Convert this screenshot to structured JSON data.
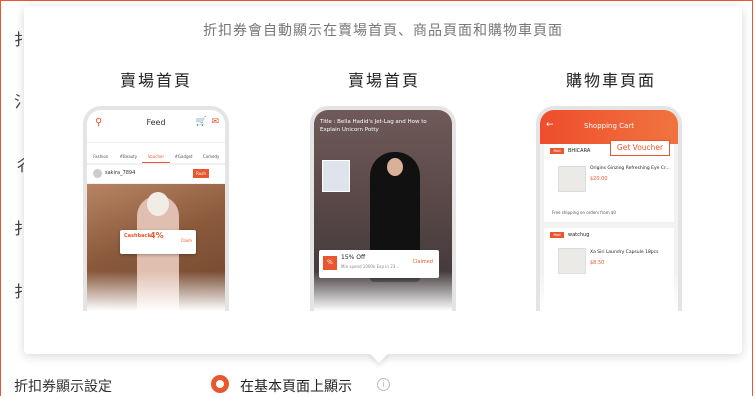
{
  "popover": {
    "caption": "折扣券會自動顯示在賣場首頁、商品頁面和購物車頁面",
    "columns": [
      {
        "title": "賣場首頁"
      },
      {
        "title": "賣場首頁"
      },
      {
        "title": "購物車頁面"
      }
    ]
  },
  "phone1": {
    "header_title": "Feed",
    "tabs": [
      "Fashion",
      "#Beauty",
      "Voucher",
      "#Gadget",
      "Comedy"
    ],
    "username": "sakira_7894",
    "follow_label": "Rush",
    "voucher_label": "Cashback",
    "voucher_value": "4%",
    "voucher_action": "Claim"
  },
  "phone2": {
    "video_title": "Title : Bella Hadid's Jet-Lag and How to Explain Unicorn Potty",
    "voucher_badge": "%",
    "voucher_title": "15% Off",
    "voucher_sub": "Min spend 1000k Exp in 23...",
    "voucher_status": "Claimed"
  },
  "phone3": {
    "header_title": "Shopping Cart",
    "shop1": "BHICARA",
    "get_voucher": "Get Voucher",
    "item1_name": "Origins Ginzing Refreshing Eye Cr...",
    "item1_price": "$20.00",
    "shipping_note": "Free shipping on orders from $0",
    "shop2": "watchug",
    "item2_name": "Xa Siri Laundry Capsule 18pcs",
    "item2_price": "$8.50"
  },
  "setting": {
    "label": "折扣券顯示設定",
    "option_label": "在基本頁面上顯示"
  },
  "background_chars": [
    "扌",
    "氵",
    "彳",
    "扌",
    "扌"
  ],
  "colors": {
    "accent": "#e8572d"
  }
}
